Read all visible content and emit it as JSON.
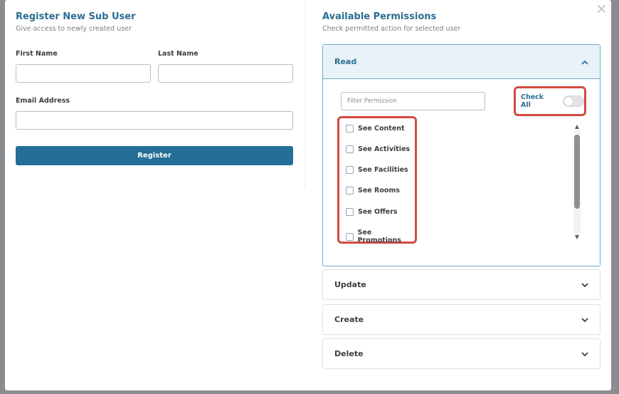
{
  "register": {
    "title": "Register New Sub User",
    "subtitle": "Give access to newly created user",
    "first_name_label": "First Name",
    "first_name_value": "",
    "last_name_label": "Last Name",
    "last_name_value": "",
    "email_label": "Email Address",
    "email_value": "",
    "submit_label": "Register"
  },
  "permissions": {
    "title": "Available Permissions",
    "subtitle": "Check permitted action for selected user",
    "filter_placeholder": "Filter Permission",
    "check_all_label": "Check All",
    "check_all_on": false,
    "sections": [
      {
        "label": "Read",
        "expanded": true,
        "items": [
          {
            "label": "See Content",
            "checked": false
          },
          {
            "label": "See Activities",
            "checked": false
          },
          {
            "label": "See Facilities",
            "checked": false
          },
          {
            "label": "See Rooms",
            "checked": false
          },
          {
            "label": "See Offers",
            "checked": false
          },
          {
            "label": "See Promotions",
            "checked": false
          }
        ]
      },
      {
        "label": "Update",
        "expanded": false
      },
      {
        "label": "Create",
        "expanded": false
      },
      {
        "label": "Delete",
        "expanded": false
      }
    ]
  },
  "icons": {
    "close": "close-icon",
    "chevron_up": "chevron-up-icon",
    "chevron_down": "chevron-down-icon"
  },
  "colors": {
    "accent": "#236f96",
    "title": "#2d6d92",
    "highlight": "#d24a40",
    "open_header_bg": "#e8f3f9"
  }
}
